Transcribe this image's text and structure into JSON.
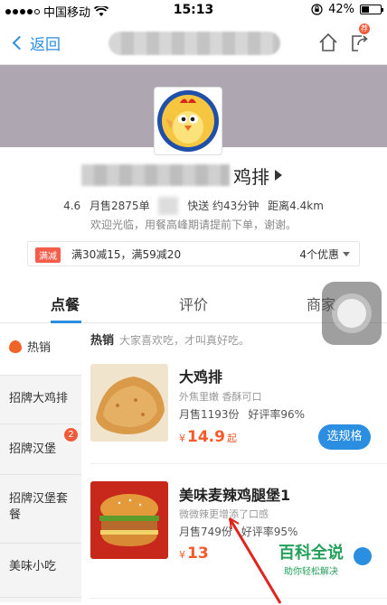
{
  "status_bar": {
    "carrier": "中国移动",
    "time": "15:13",
    "battery": "42%",
    "battery_level": 0.42
  },
  "navbar": {
    "back_label": "返回",
    "share_badge": "荐"
  },
  "store": {
    "name_suffix": "鸡排",
    "rating": "4.6",
    "monthly_sales": "月售2875单",
    "delivery": "快送 约43分钟",
    "distance": "距离4.4km",
    "notice": "欢迎光临，用餐高峰期请提前下单，谢谢。",
    "promo_tag": "满减",
    "promo_text": "满30减15，满59减20",
    "promo_count": "4个优惠"
  },
  "tabs": [
    {
      "label": "点餐",
      "active": true
    },
    {
      "label": "评价",
      "active": false
    },
    {
      "label": "商家",
      "active": false
    }
  ],
  "sidebar": [
    {
      "label": "热销",
      "active": true
    },
    {
      "label": "招牌大鸡排"
    },
    {
      "label": "招牌汉堡",
      "badge": "2"
    },
    {
      "label": "招牌汉堡套餐"
    },
    {
      "label": "美味小吃"
    }
  ],
  "section": {
    "title": "热销",
    "subtitle": "大家喜欢吃，才叫真好吃。"
  },
  "items": [
    {
      "name": "大鸡排",
      "desc": "外焦里嫩 香酥可口",
      "sales": "月售1193份",
      "rating": "好评率96%",
      "currency": "¥",
      "price": "14.9",
      "price_suffix": "起",
      "button": "选规格"
    },
    {
      "name": "美味麦辣鸡腿堡1",
      "desc": "微微辣更增添了口感",
      "sales": "月售749份",
      "rating": "好评率95%",
      "currency": "¥",
      "price": "13"
    }
  ],
  "watermark": {
    "title": "百科全说",
    "subtitle": "助你轻松解决"
  },
  "colors": {
    "accent": "#2b8ee0",
    "price": "#f45a2a",
    "promo": "#f45d4a",
    "header": "#aea6b0"
  }
}
